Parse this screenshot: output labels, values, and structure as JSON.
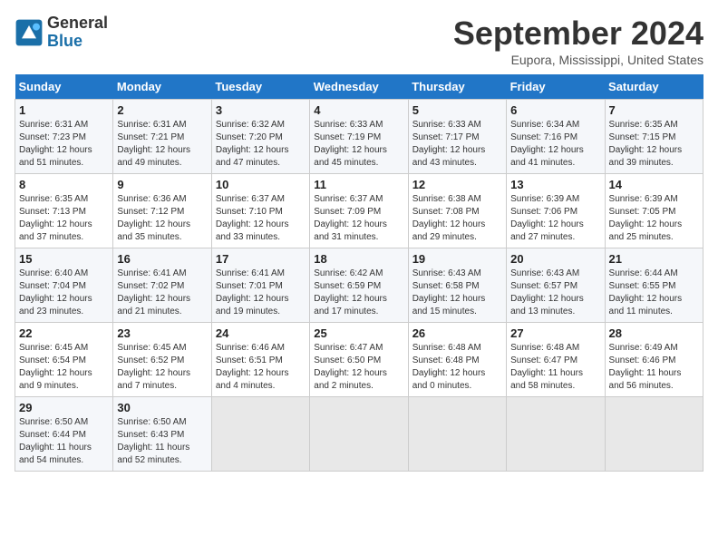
{
  "logo": {
    "line1": "General",
    "line2": "Blue"
  },
  "title": "September 2024",
  "subtitle": "Eupora, Mississippi, United States",
  "days_of_week": [
    "Sunday",
    "Monday",
    "Tuesday",
    "Wednesday",
    "Thursday",
    "Friday",
    "Saturday"
  ],
  "weeks": [
    [
      {
        "day": "1",
        "sunrise": "6:31 AM",
        "sunset": "7:23 PM",
        "daylight": "12 hours and 51 minutes."
      },
      {
        "day": "2",
        "sunrise": "6:31 AM",
        "sunset": "7:21 PM",
        "daylight": "12 hours and 49 minutes."
      },
      {
        "day": "3",
        "sunrise": "6:32 AM",
        "sunset": "7:20 PM",
        "daylight": "12 hours and 47 minutes."
      },
      {
        "day": "4",
        "sunrise": "6:33 AM",
        "sunset": "7:19 PM",
        "daylight": "12 hours and 45 minutes."
      },
      {
        "day": "5",
        "sunrise": "6:33 AM",
        "sunset": "7:17 PM",
        "daylight": "12 hours and 43 minutes."
      },
      {
        "day": "6",
        "sunrise": "6:34 AM",
        "sunset": "7:16 PM",
        "daylight": "12 hours and 41 minutes."
      },
      {
        "day": "7",
        "sunrise": "6:35 AM",
        "sunset": "7:15 PM",
        "daylight": "12 hours and 39 minutes."
      }
    ],
    [
      {
        "day": "8",
        "sunrise": "6:35 AM",
        "sunset": "7:13 PM",
        "daylight": "12 hours and 37 minutes."
      },
      {
        "day": "9",
        "sunrise": "6:36 AM",
        "sunset": "7:12 PM",
        "daylight": "12 hours and 35 minutes."
      },
      {
        "day": "10",
        "sunrise": "6:37 AM",
        "sunset": "7:10 PM",
        "daylight": "12 hours and 33 minutes."
      },
      {
        "day": "11",
        "sunrise": "6:37 AM",
        "sunset": "7:09 PM",
        "daylight": "12 hours and 31 minutes."
      },
      {
        "day": "12",
        "sunrise": "6:38 AM",
        "sunset": "7:08 PM",
        "daylight": "12 hours and 29 minutes."
      },
      {
        "day": "13",
        "sunrise": "6:39 AM",
        "sunset": "7:06 PM",
        "daylight": "12 hours and 27 minutes."
      },
      {
        "day": "14",
        "sunrise": "6:39 AM",
        "sunset": "7:05 PM",
        "daylight": "12 hours and 25 minutes."
      }
    ],
    [
      {
        "day": "15",
        "sunrise": "6:40 AM",
        "sunset": "7:04 PM",
        "daylight": "12 hours and 23 minutes."
      },
      {
        "day": "16",
        "sunrise": "6:41 AM",
        "sunset": "7:02 PM",
        "daylight": "12 hours and 21 minutes."
      },
      {
        "day": "17",
        "sunrise": "6:41 AM",
        "sunset": "7:01 PM",
        "daylight": "12 hours and 19 minutes."
      },
      {
        "day": "18",
        "sunrise": "6:42 AM",
        "sunset": "6:59 PM",
        "daylight": "12 hours and 17 minutes."
      },
      {
        "day": "19",
        "sunrise": "6:43 AM",
        "sunset": "6:58 PM",
        "daylight": "12 hours and 15 minutes."
      },
      {
        "day": "20",
        "sunrise": "6:43 AM",
        "sunset": "6:57 PM",
        "daylight": "12 hours and 13 minutes."
      },
      {
        "day": "21",
        "sunrise": "6:44 AM",
        "sunset": "6:55 PM",
        "daylight": "12 hours and 11 minutes."
      }
    ],
    [
      {
        "day": "22",
        "sunrise": "6:45 AM",
        "sunset": "6:54 PM",
        "daylight": "12 hours and 9 minutes."
      },
      {
        "day": "23",
        "sunrise": "6:45 AM",
        "sunset": "6:52 PM",
        "daylight": "12 hours and 7 minutes."
      },
      {
        "day": "24",
        "sunrise": "6:46 AM",
        "sunset": "6:51 PM",
        "daylight": "12 hours and 4 minutes."
      },
      {
        "day": "25",
        "sunrise": "6:47 AM",
        "sunset": "6:50 PM",
        "daylight": "12 hours and 2 minutes."
      },
      {
        "day": "26",
        "sunrise": "6:48 AM",
        "sunset": "6:48 PM",
        "daylight": "12 hours and 0 minutes."
      },
      {
        "day": "27",
        "sunrise": "6:48 AM",
        "sunset": "6:47 PM",
        "daylight": "11 hours and 58 minutes."
      },
      {
        "day": "28",
        "sunrise": "6:49 AM",
        "sunset": "6:46 PM",
        "daylight": "11 hours and 56 minutes."
      }
    ],
    [
      {
        "day": "29",
        "sunrise": "6:50 AM",
        "sunset": "6:44 PM",
        "daylight": "11 hours and 54 minutes."
      },
      {
        "day": "30",
        "sunrise": "6:50 AM",
        "sunset": "6:43 PM",
        "daylight": "11 hours and 52 minutes."
      },
      null,
      null,
      null,
      null,
      null
    ]
  ]
}
